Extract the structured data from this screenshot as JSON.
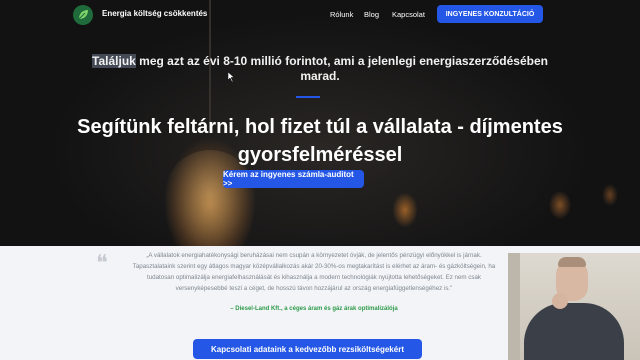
{
  "header": {
    "logo_text": "Energia költség csökkentés",
    "logo_icon": "leaf-icon",
    "nav": [
      {
        "label": "Rólunk"
      },
      {
        "label": "Blog"
      },
      {
        "label": "Kapcsolat"
      }
    ],
    "cta_label": "INGYENES KONZULTÁCIÓ"
  },
  "hero": {
    "subtitle_highlight": "Találjuk",
    "subtitle_rest": " meg azt az évi 8-10 millió forintot, ami a jelenlegi energiaszerződésében marad.",
    "title": "Segítünk feltárni, hol fizet túl a vállalata - díjmentes gyorsfelméréssel",
    "cta_label": "Kérem az ingyenes számla-auditot >>"
  },
  "testimonial": {
    "quote_icon": "quote-icon",
    "text": "„A vállalatok energiahatékonysági beruházásai nem csupán a környezetet óvják, de jelentős pénzügyi előnyökkel is járnak. Tapasztalataink szerint egy átlagos magyar középvállalkozás akár 20-30%-os megtakarítást is elérhet az áram- és gázköltségein, ha tudatosan optimalizálja energiafelhasználását és kihasználja a modern technológiák nyújtotta lehetőségeket. Ez nem csak versenyképesebbé teszi a céget, de hosszú távon hozzájárul az ország energiafüggetlenségéhez is.\"",
    "author": "– Diesel-Land Kft., a céges áram és gáz árak optimalizálója"
  },
  "section_cta_label": "Kapcsolati adataink a kedvezőbb rezsiköltségekért",
  "colors": {
    "accent": "#2457e6",
    "author_green": "#2e9a4a",
    "section_bg": "#f2f4f7"
  }
}
